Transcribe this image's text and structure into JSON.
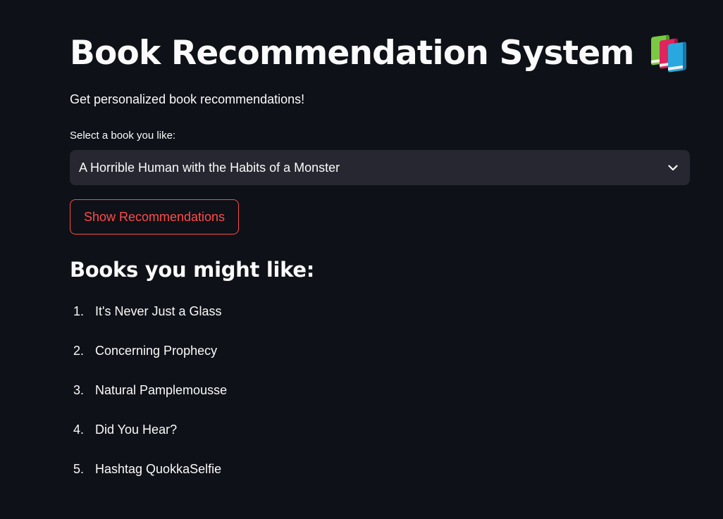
{
  "page": {
    "title": "Book Recommendation System",
    "title_icon": "books-icon",
    "subtitle": "Get personalized book recommendations!"
  },
  "select": {
    "label": "Select a book you like:",
    "value": "A Horrible Human with the Habits of a Monster",
    "icon": "chevron-down-icon"
  },
  "button": {
    "label": "Show Recommendations"
  },
  "recommendations": {
    "heading": "Books you might like:",
    "items": [
      {
        "num": "1.",
        "title": "It's Never Just a Glass"
      },
      {
        "num": "2.",
        "title": "Concerning Prophecy"
      },
      {
        "num": "3.",
        "title": "Natural Pamplemousse"
      },
      {
        "num": "4.",
        "title": "Did You Hear?"
      },
      {
        "num": "5.",
        "title": "Hashtag QuokkaSelfie"
      }
    ]
  },
  "colors": {
    "background": "#0e1117",
    "text": "#fafafa",
    "input_bg": "#262730",
    "accent": "#ff4b4b"
  }
}
